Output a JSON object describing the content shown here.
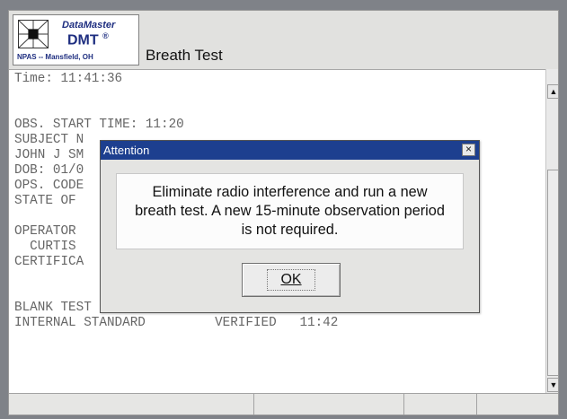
{
  "header": {
    "logo_brand": "DataMaster",
    "logo_model": "DMT",
    "logo_reg": "®",
    "logo_location": "NPAS -- Mansfield, OH",
    "title": "Breath Test"
  },
  "log_lines": [
    "Time: 11:41:36",
    "",
    "",
    "OBS. START TIME: 11:20",
    "SUBJECT N",
    "JOHN J SM",
    "DOB: 01/0",
    "OPS. CODE",
    "STATE OF",
    "",
    "OPERATOR",
    "  CURTIS",
    "CERTIFICA",
    "",
    "",
    "BLANK TEST                    0.00   11:42",
    "INTERNAL STANDARD         VERIFIED   11:42"
  ],
  "dialog": {
    "title": "Attention",
    "close_glyph": "×",
    "message": "Eliminate radio interference and run a new breath test. A new 15-minute observation period is not required.",
    "ok_label": "OK"
  },
  "scrollbar": {
    "up_icon": "up-arrow-icon",
    "down_icon": "down-arrow-icon",
    "up_glyph": "▲",
    "down_glyph": "▼"
  },
  "colors": {
    "dialog_title_bar": "#1d3f8f",
    "logo_text": "#1e2e80",
    "log_text": "#666666"
  }
}
